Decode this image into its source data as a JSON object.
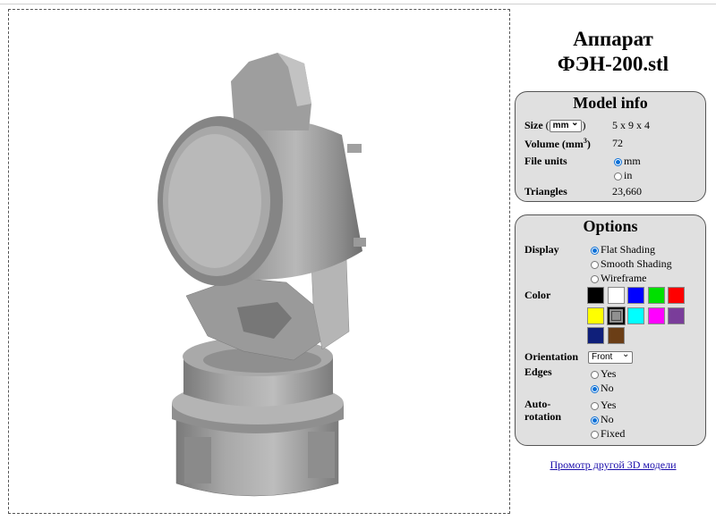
{
  "title_line1": "Аппарат",
  "title_line2": "ФЭН-200.stl",
  "model_info": {
    "heading": "Model info",
    "size_label": "Size",
    "size_unit": "mm",
    "size_value": "5 x 9 x 4",
    "volume_label": "Volume (mm",
    "volume_sup": "3",
    "volume_close": ")",
    "volume_value": "72",
    "file_units_label": "File units",
    "unit_mm": "mm",
    "unit_in": "in",
    "triangles_label": "Triangles",
    "triangles_value": "23,660"
  },
  "options": {
    "heading": "Options",
    "display_label": "Display",
    "display_flat": "Flat Shading",
    "display_smooth": "Smooth Shading",
    "display_wire": "Wireframe",
    "color_label": "Color",
    "colors": [
      "#000000",
      "#ffffff",
      "#0000ff",
      "#00e000",
      "#ff0000",
      "#ffff00",
      "#909090",
      "#00ffff",
      "#ff00ff",
      "#7a3d9a",
      "#0f1f7a",
      "#6b3e16"
    ],
    "orientation_label": "Orientation",
    "orientation_value": "Front",
    "edges_label": "Edges",
    "yes": "Yes",
    "no": "No",
    "autorot_label1": "Auto-",
    "autorot_label2": "rotation",
    "fixed": "Fixed"
  },
  "other_link": "Промотр другой 3D модели"
}
